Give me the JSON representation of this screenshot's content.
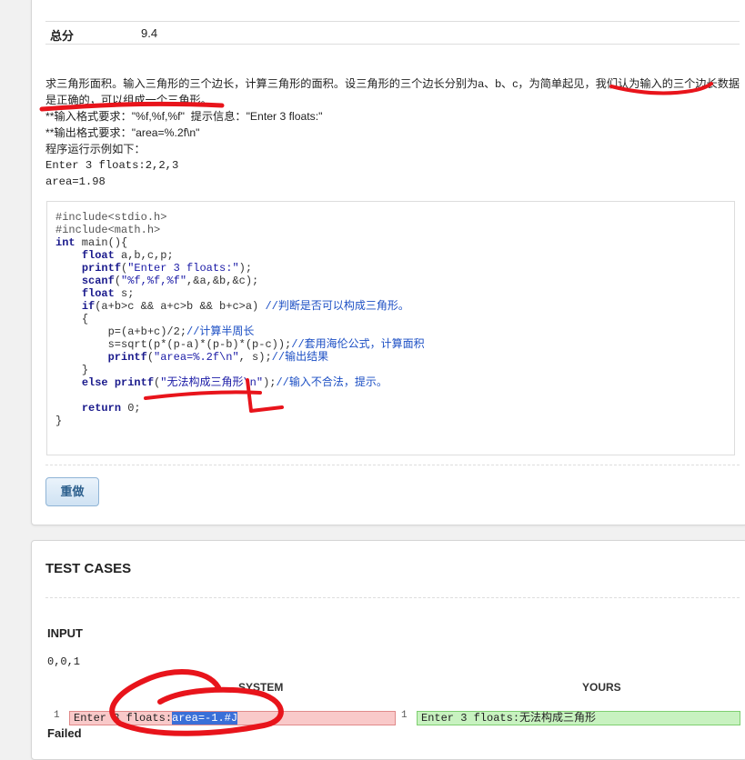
{
  "score": {
    "label": "总分",
    "value": "9.4"
  },
  "problem": {
    "lines": [
      "求三角形面积。输入三角形的三个边长，计算三角形的面积。设三角形的三个边长分别为a、b、c，为简单起见，我们认为输入的三个边长数据",
      "是正确的，可以组成一个三角形。",
      "**输入格式要求：\"%f,%f,%f\"  提示信息：\"Enter 3 floats:\"",
      "**输出格式要求：\"area=%.2f\\n\"",
      "程序运行示例如下：",
      "Enter 3 floats:2,2,3",
      "area=1.98"
    ]
  },
  "code": {
    "l1": "#include<stdio.h>",
    "l2": "#include<math.h>",
    "l3_kw": "int",
    "l3_rest": " main(){",
    "l4_kw": "float",
    "l4_rest": " a,b,c,p;",
    "l5_fn": "printf",
    "l5_str": "\"Enter 3 floats:\"",
    "l6_fn": "scanf",
    "l6_str": "\"%f,%f,%f\"",
    "l6_rest": ",&a,&b,&c);",
    "l7_kw": "float",
    "l7_rest": " s;",
    "l8_kw": "if",
    "l8_rest": "(a+b>c && a+c>b && b+c>a) ",
    "l8_cmt": "//判断是否可以构成三角形。",
    "l9": "{",
    "l10": "p=(a+b+c)/2;",
    "l10_cmt": "//计算半周长",
    "l11": "s=sqrt(p*(p-a)*(p-b)*(p-c));",
    "l11_cmt": "//套用海伦公式，计算面积",
    "l12_fn": "printf",
    "l12_str": "\"area=%.2f\\n\"",
    "l12_rest": ", s);",
    "l12_cmt": "//输出结果",
    "l13": "}",
    "l14_kw": "else",
    "l14_fn": "printf",
    "l14_str": "\"无法构成三角形\\n\"",
    "l14_rest": ");",
    "l14_cmt": "//输入不合法，提示。",
    "l16_kw": "return",
    "l16_rest": " 0;",
    "l17": "}"
  },
  "redo_label": "重做",
  "tests": {
    "title": "TEST CASES",
    "input_title": "INPUT",
    "input_value": "0,0,1",
    "system_header": "SYSTEM",
    "yours_header": "YOURS",
    "line_no": "1",
    "system_prefix": "Enter 3 floats:",
    "system_highlight": "area=-1.#J",
    "yours_output": "Enter 3 floats:无法构成三角形",
    "result": "Failed"
  },
  "colors": {
    "scribble": "#e8141b"
  }
}
